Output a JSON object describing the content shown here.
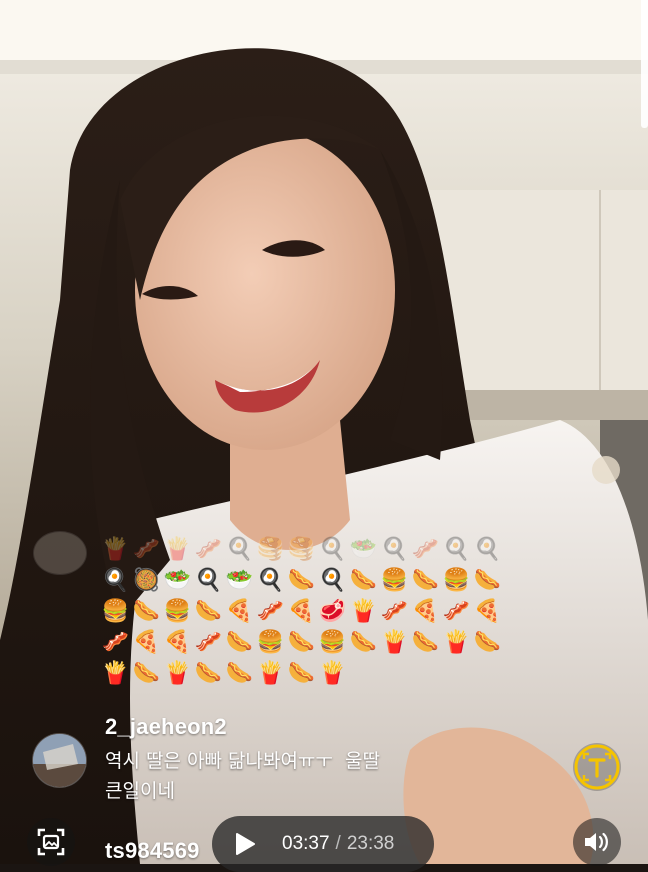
{
  "stream": {
    "emoji_rows": [
      [
        "🍟",
        "🥓",
        "🍟",
        "🥓",
        "🍳",
        "🥞",
        "🥞",
        "🍳",
        "🥗",
        "🍳",
        "🥓",
        "🍳",
        "🍳"
      ],
      [
        "🍳",
        "🥘",
        "🥗",
        "🍳",
        "🥗",
        "🍳",
        "🌭",
        "🍳",
        "🌭",
        "🍔",
        "🌭",
        "🍔",
        "🌭"
      ],
      [
        "🍔",
        "🌭",
        "🍔",
        "🌭",
        "🍕",
        "🥓",
        "🍕",
        "🥩",
        "🍟",
        "🥓",
        "🍕",
        "🥓",
        "🍕"
      ],
      [
        "🥓",
        "🍕",
        "🍕",
        "🥓",
        "🌭",
        "🍔",
        "🌭",
        "🍔",
        "🌭",
        "🍟",
        "🌭",
        "🍟",
        "🌭"
      ],
      [
        "🍟",
        "🌭",
        "🍟",
        "🌭",
        "🌭",
        "🍟",
        "🌭",
        "🍟"
      ]
    ],
    "comments": [
      {
        "username": "2_jaeheon2",
        "text": "역시 딸은 아빠 닮나봐여ㅠㅜ  울딸\n큰일이네"
      },
      {
        "username": "ts984569",
        "text": ""
      }
    ]
  },
  "player": {
    "current_time": "03:37",
    "separator": "/",
    "duration": "23:38",
    "play_icon": "play-icon",
    "volume_icon": "speaker-icon",
    "translate_icon": "text-translate-icon",
    "screenshot_icon": "photo-capture-icon",
    "accent_color": "#f5c400"
  }
}
